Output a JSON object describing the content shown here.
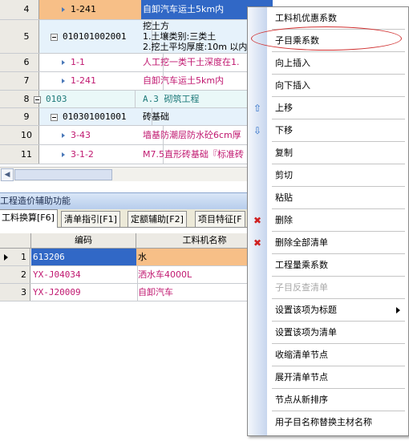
{
  "top_grid": {
    "rows": [
      {
        "row": "4",
        "code": "1-241",
        "name": "自卸汽车运土5km内",
        "kind": "sub"
      },
      {
        "row": "5",
        "code": "010101002001",
        "name": "挖土方",
        "name_line2": "1.土壤类别:三类土",
        "name_line3": "2.挖土平均厚度:10m 以内",
        "kind": "list"
      },
      {
        "row": "6",
        "code": "1-1",
        "name": "人工挖一类干土深度在1.",
        "kind": "sub"
      },
      {
        "row": "7",
        "code": "1-241",
        "name": "自卸汽车运土5km内",
        "kind": "sub"
      },
      {
        "row": "8",
        "code": "0103",
        "name": "A.3 砌筑工程",
        "kind": "section"
      },
      {
        "row": "9",
        "code": "010301001001",
        "name": "砖基础",
        "kind": "list"
      },
      {
        "row": "10",
        "code": "3-43",
        "name": "墙基防潮层防水砼6cm厚",
        "kind": "sub"
      },
      {
        "row": "11",
        "code": "3-1-2",
        "name": "M7.5直形砖基础『标准砖",
        "kind": "sub"
      }
    ]
  },
  "panel": {
    "title": "工程造价辅助功能",
    "tabs": [
      "工料换算[F6]",
      "清单指引[F1]",
      "定额辅助[F2]",
      "项目特征[F"
    ],
    "grid": {
      "headers": [
        "编码",
        "工料机名称"
      ],
      "rows": [
        {
          "idx": "1",
          "code": "613206",
          "name": "水"
        },
        {
          "idx": "2",
          "code": "YX-J04034",
          "name": "洒水车4000L"
        },
        {
          "idx": "3",
          "code": "YX-J20009",
          "name": "自卸汽车"
        }
      ]
    }
  },
  "context_menu": {
    "items": [
      {
        "label": "工料机优惠系数",
        "icon": "",
        "enabled": true
      },
      {
        "label": "子目乘系数",
        "icon": "",
        "enabled": true
      },
      {
        "label": "向上插入",
        "icon": "",
        "enabled": true
      },
      {
        "label": "向下插入",
        "icon": "",
        "enabled": true
      },
      {
        "label": "上移",
        "icon": "up-arrow-icon",
        "enabled": true
      },
      {
        "label": "下移",
        "icon": "down-arrow-icon",
        "enabled": true
      },
      {
        "label": "复制",
        "icon": "",
        "enabled": true
      },
      {
        "label": "剪切",
        "icon": "",
        "enabled": true
      },
      {
        "label": "粘贴",
        "icon": "",
        "enabled": true
      },
      {
        "label": "删除",
        "icon": "delete-icon",
        "enabled": true
      },
      {
        "label": "删除全部清单",
        "icon": "delete-icon",
        "enabled": true
      },
      {
        "label": "工程量乘系数",
        "icon": "",
        "enabled": true
      },
      {
        "label": "子目反查清单",
        "icon": "",
        "enabled": false
      },
      {
        "label": "设置该项为标题",
        "icon": "",
        "enabled": true,
        "submenu": true
      },
      {
        "label": "设置该项为清单",
        "icon": "",
        "enabled": true
      },
      {
        "label": "收缩清单节点",
        "icon": "",
        "enabled": true
      },
      {
        "label": "展开清单节点",
        "icon": "",
        "enabled": true
      },
      {
        "label": "节点从新排序",
        "icon": "",
        "enabled": true
      },
      {
        "label": "用子目名称替换主材名称",
        "icon": "",
        "enabled": true
      }
    ]
  },
  "colors": {
    "selected_row": "#f7bf87",
    "selected_name_cell": "#3168c6",
    "sub_text": "#c01870",
    "section_text": "#1e7a7a",
    "highlight_oval": "#d03030"
  }
}
